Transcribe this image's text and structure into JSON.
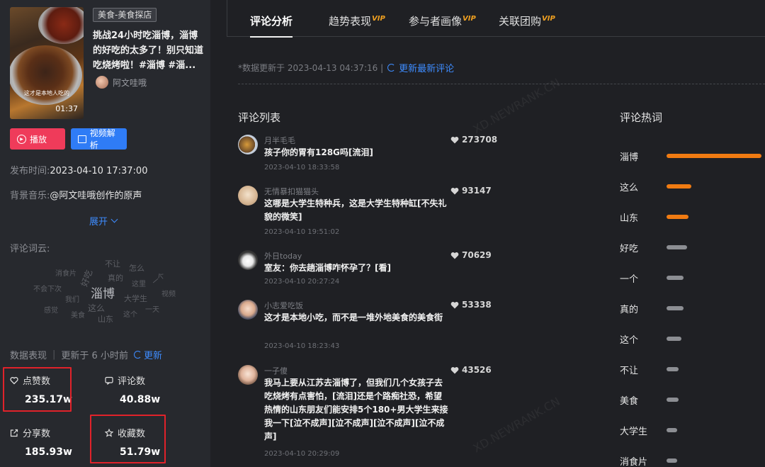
{
  "video": {
    "tag": "美食-美食探店",
    "title": "挑战24小时吃淄博，淄博的好吃的太多了！别只知道吃烧烤啦！#淄博 #淄...",
    "thumb_caption": "这才是本地人吃的",
    "duration": "01:37",
    "author": "阿文哇哦"
  },
  "buttons": {
    "play": "播放",
    "analyze": "视频解析"
  },
  "meta": {
    "publish_label": "发布时间:",
    "publish_value": "2023-04-10 17:37:00",
    "music_label": "背景音乐:",
    "music_value": "@阿文哇哦创作的原声",
    "expand": "展开"
  },
  "cloud": {
    "label": "评论词云:",
    "words": [
      "淄博",
      "好吃",
      "不让",
      "怎么",
      "真的",
      "消食片",
      "不会下次",
      "大学生",
      "视频",
      "我们",
      "这么",
      "一天",
      "感觉",
      "美食",
      "山东",
      "这个",
      "一个",
      "这里"
    ]
  },
  "stats_header": {
    "title": "数据表现",
    "updated": "更新于 6 小时前",
    "refresh": "更新"
  },
  "stats": [
    {
      "label": "点赞数",
      "value": "235.17w",
      "icon": "heart-icon"
    },
    {
      "label": "评论数",
      "value": "40.88w",
      "icon": "comment-icon"
    },
    {
      "label": "分享数",
      "value": "185.93w",
      "icon": "share-icon"
    },
    {
      "label": "收藏数",
      "value": "51.79w",
      "icon": "star-icon"
    }
  ],
  "tabs": [
    {
      "label": "评论分析",
      "vip": "",
      "active": true
    },
    {
      "label": "趋势表现",
      "vip": "VIP",
      "active": false
    },
    {
      "label": "参与者画像",
      "vip": "VIP",
      "active": false
    },
    {
      "label": "关联团购",
      "vip": "VIP",
      "active": false
    }
  ],
  "update": {
    "text": "*数据更新于 2023-04-13 04:37:16 |",
    "link": "更新最新评论"
  },
  "comments_title": "评论列表",
  "comments": [
    {
      "user": "月半毛毛",
      "text": "孩子你的胃有128G吗[流泪]",
      "time": "2023-04-10 18:33:58",
      "likes": "273708"
    },
    {
      "user": "无情暴扣猫猫头",
      "text": "这哪是大学生特种兵，这是大学生特种缸[不失礼貌的微笑]",
      "time": "2023-04-10 19:51:02",
      "likes": "93147"
    },
    {
      "user": "外日today",
      "text": "室友：你去趟淄博咋怀孕了？[看]",
      "time": "2023-04-10 20:27:24",
      "likes": "70629"
    },
    {
      "user": "小志爱吃饭",
      "text": "这才是本地小吃，而不是一堆外地美食的美食街",
      "time": "2023-04-10 18:23:43",
      "likes": "53338"
    },
    {
      "user": "一子傻",
      "text": "我马上要从江苏去淄博了，但我们几个女孩子去吃烧烤有点害怕，[流泪]还是个路痴社恐，希望热情的山东朋友们能安排5个180+男大学生来接我一下[泣不成声][泣不成声][泣不成声][泣不成声]",
      "time": "2023-04-10 20:29:09",
      "likes": "43526"
    }
  ],
  "keywords_title": "评论热词",
  "keywords": [
    {
      "word": "淄博",
      "level": 1.0,
      "color": "#f07b12"
    },
    {
      "word": "这么",
      "level": 0.26,
      "color": "#f07b12"
    },
    {
      "word": "山东",
      "level": 0.23,
      "color": "#f07b12"
    },
    {
      "word": "好吃",
      "level": 0.22,
      "color": "#8c8e93"
    },
    {
      "word": "一个",
      "level": 0.18,
      "color": "#8c8e93"
    },
    {
      "word": "真的",
      "level": 0.18,
      "color": "#8c8e93"
    },
    {
      "word": "这个",
      "level": 0.16,
      "color": "#8c8e93"
    },
    {
      "word": "不让",
      "level": 0.13,
      "color": "#8c8e93"
    },
    {
      "word": "美食",
      "level": 0.13,
      "color": "#8c8e93"
    },
    {
      "word": "大学生",
      "level": 0.11,
      "color": "#8c8e93"
    },
    {
      "word": "消食片",
      "level": 0.11,
      "color": "#8c8e93"
    }
  ]
}
